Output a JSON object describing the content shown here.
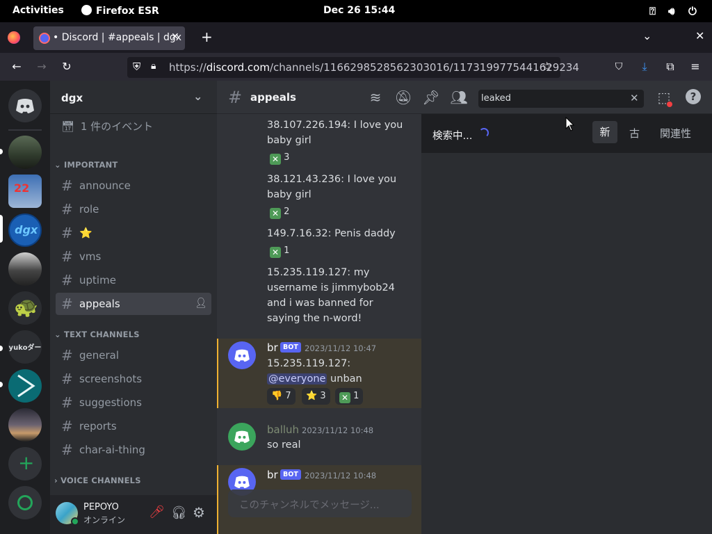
{
  "topbar": {
    "activities": "Activities",
    "app_name": "Firefox ESR",
    "clock": "Dec 26  15:44"
  },
  "browser": {
    "tab_title": "• Discord | #appeals | dgx",
    "url_prefix": "https://",
    "url_domain": "discord.com",
    "url_path": "/channels/1166298528562303016/1173199775441629234"
  },
  "server": {
    "name": "dgx",
    "event": "1 件のイベント",
    "categories": {
      "important": "IMPORTANT",
      "text": "TEXT CHANNELS",
      "voice": "VOICE CHANNELS"
    },
    "important_channels": [
      "announce",
      "role",
      "⭐",
      "vms",
      "uptime",
      "appeals"
    ],
    "text_channels": [
      "general",
      "screenshots",
      "suggestions",
      "reports",
      "char-ai-thing"
    ]
  },
  "guild_labels": {
    "yuko": "yukoダー"
  },
  "user": {
    "name": "PEPOYO",
    "status": "オンライン"
  },
  "channel": {
    "name": "appeals",
    "composer_placeholder": "このチャンネルでメッセージ..."
  },
  "search": {
    "query": "leaked",
    "status": "検索中...",
    "sort_new": "新",
    "sort_old": "古",
    "sort_relevance": "関連性"
  },
  "messages": {
    "m1": {
      "text": "38.107.226.194: I love you baby girl",
      "line1": "38.107.226.194: I love you",
      "line2": "baby girl",
      "react_count": "3"
    },
    "m2": {
      "text": "38.121.43.236: I love you baby girl",
      "line1": "38.121.43.236: I love you",
      "line2": "baby girl",
      "react_count": "2"
    },
    "m3": {
      "line1": "149.7.16.32: Penis daddy",
      "react_count": "1"
    },
    "m4": {
      "line1": "15.235.119.127: my",
      "line2": "username is jimmybob24",
      "line3": "and i was banned for",
      "line4": "saying the n-word!"
    },
    "m5": {
      "author": "br",
      "badge": "BOT",
      "time": "2023/11/12 10:47",
      "line1": "15.235.119.127:",
      "mention": "@everyone",
      "after_mention": " unban",
      "r_thumbs": "7",
      "r_star": "3",
      "r_x": "1"
    },
    "m6": {
      "author": "balluh",
      "time": "2023/11/12 10:48",
      "line1": "so real"
    },
    "m7": {
      "author": "br",
      "badge": "BOT",
      "time": "2023/11/12 10:48"
    }
  },
  "colors": {
    "accent": "#5865f2",
    "bot_highlight": "#3e3a30",
    "highlight_bar": "#f0b232",
    "online": "#23a55a",
    "balluh_avatar": "#3ba55c",
    "bot_avatar": "#5865f2"
  }
}
